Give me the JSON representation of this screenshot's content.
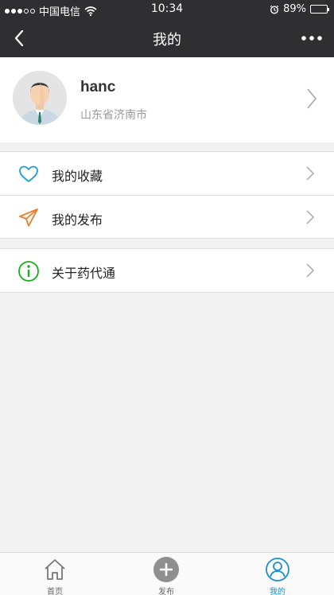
{
  "status_bar": {
    "carrier": "中国电信",
    "time": "10:34",
    "battery": "89%",
    "battery_level": 0.89
  },
  "nav": {
    "title": "我的",
    "back_icon": "chevron-left-icon",
    "more_icon": "more-dots-icon"
  },
  "profile": {
    "username": "hanc",
    "location": "山东省济南市"
  },
  "menu_groups": [
    {
      "items": [
        {
          "label": "我的收藏",
          "icon": "heart-icon",
          "color": "#1aa0d8"
        },
        {
          "label": "我的发布",
          "icon": "paper-plane-icon",
          "color": "#f07c28"
        }
      ]
    },
    {
      "items": [
        {
          "label": "关于药代通",
          "icon": "info-icon",
          "color": "#12b01a"
        }
      ]
    }
  ],
  "tabbar": {
    "items": [
      {
        "label": "首页",
        "icon": "home-icon",
        "active": false
      },
      {
        "label": "发布",
        "icon": "plus-circle-icon",
        "active": false
      },
      {
        "label": "我的",
        "icon": "user-icon",
        "active": true
      }
    ]
  },
  "colors": {
    "header_bg": "#2f2f31",
    "active_tab": "#1b8fd1",
    "page_bg": "#f2f2f2"
  }
}
